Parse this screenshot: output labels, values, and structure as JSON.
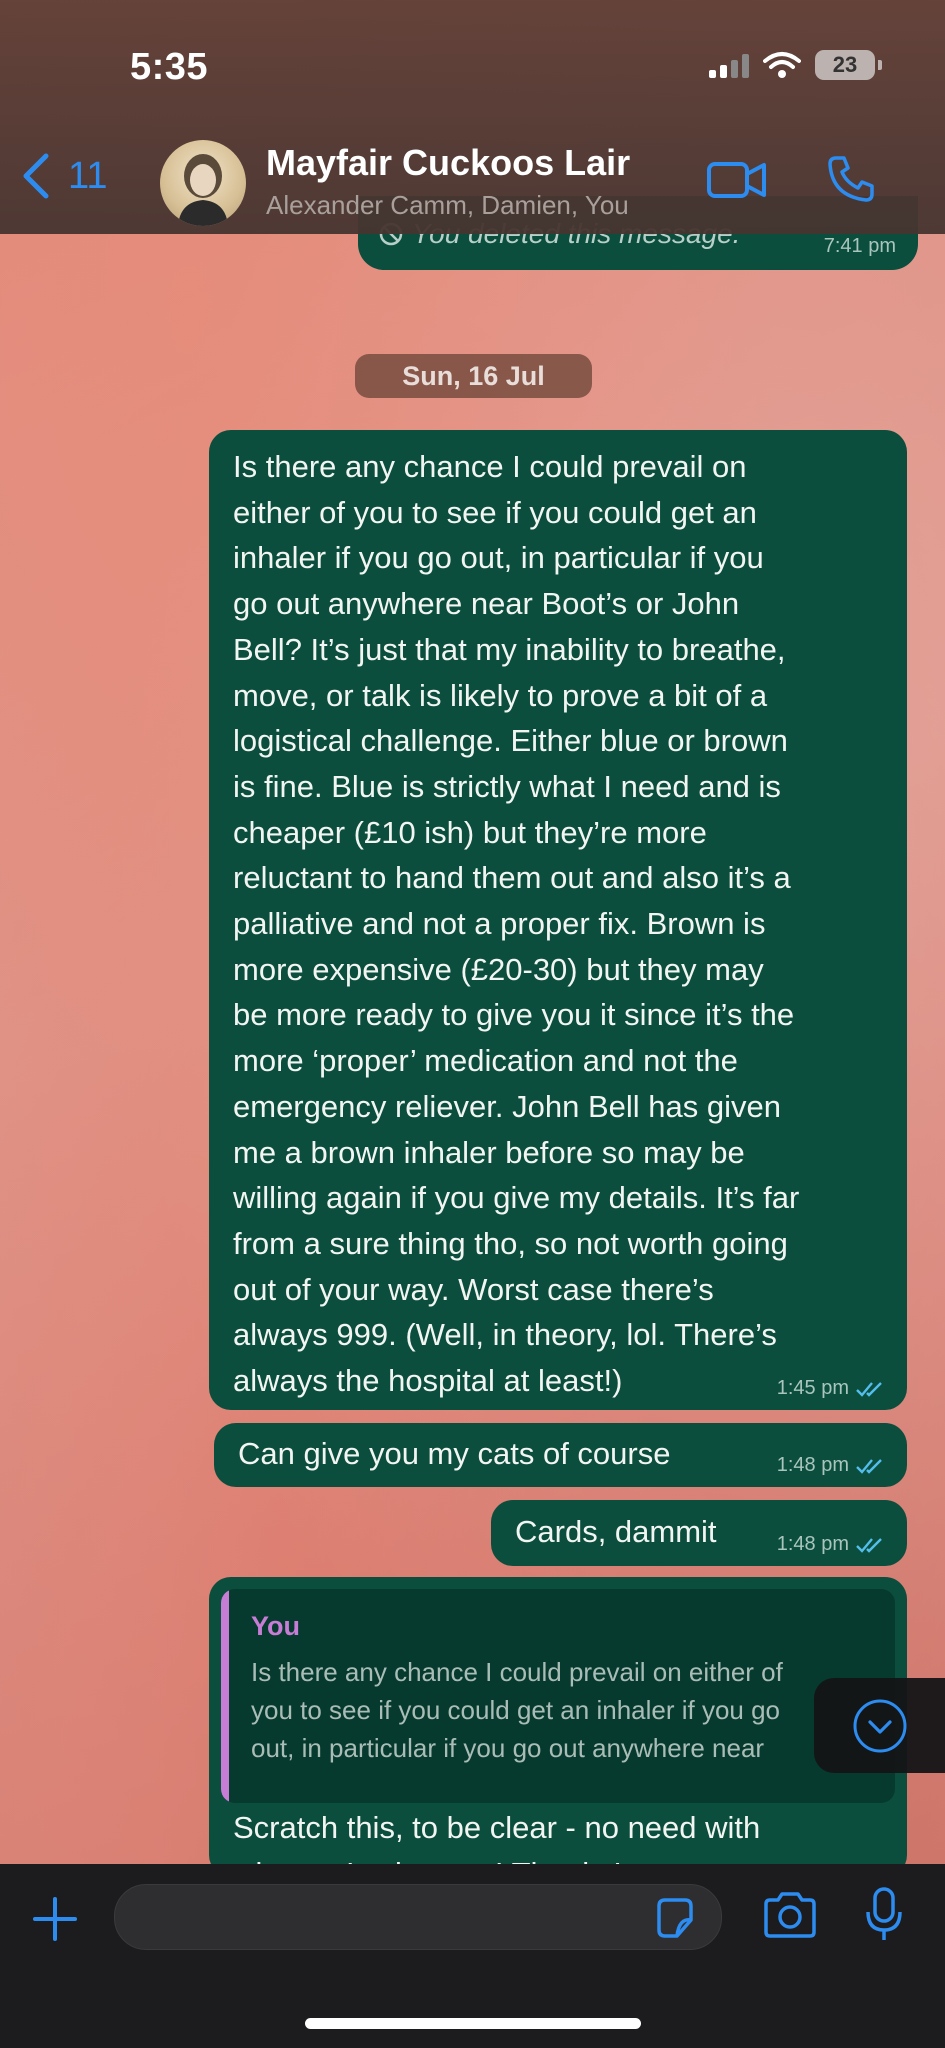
{
  "status_bar": {
    "time": "5:35",
    "battery": "23"
  },
  "header": {
    "back_count": "11",
    "title": "Mayfair Cuckoos Lair",
    "subtitle": "Alexander Camm, Damien, You"
  },
  "messages": {
    "deleted": {
      "text": "You deleted this message.",
      "time": "7:41 pm"
    },
    "date_separator": "Sun, 16 Jul",
    "m1": {
      "lines": [
        "Is there any chance I could prevail on",
        "either of you to see if you could get an",
        "inhaler if you go out, in particular if you",
        "go out anywhere near Boot’s or John",
        "Bell? It’s just that my inability to breathe,",
        "move, or talk is likely to prove a bit of a",
        "logistical challenge. Either blue or brown",
        "is fine. Blue is strictly what I need and is",
        "cheaper (£10 ish) but they’re more",
        "reluctant to hand them out and also it’s a",
        "palliative and not a proper fix. Brown is",
        "more expensive (£20-30) but they may",
        "be more ready to give you it since it’s the",
        "more ‘proper’ medication and not the",
        "emergency reliever. John Bell has given",
        "me a brown inhaler before so may be",
        "willing again if you give my details. It’s far",
        "from a sure thing tho, so not worth going",
        "out of your way. Worst case there’s",
        "always 999. (Well, in theory, lol. There’s",
        "always the hospital at least!)"
      ],
      "time": "1:45 pm"
    },
    "m2": {
      "text": "Can give you my cats of course",
      "time": "1:48 pm"
    },
    "m3": {
      "text": "Cards, dammit",
      "time": "1:48 pm"
    },
    "m4": {
      "quote_author": "You",
      "quote_lines": [
        "Is there any chance I could prevail on either of",
        "you to see if you could get an inhaler if you go",
        "out, in particular if you go out anywhere near"
      ],
      "text": "Scratch this, to be clear - no need with",
      "text_cut": "what we’ve just got! Thanks!"
    }
  },
  "colors": {
    "accent": "#2d8cf0",
    "bubble": "#0b4e3d",
    "quote_author": "#c77dd6",
    "read_ticks": "#53bdeb"
  }
}
